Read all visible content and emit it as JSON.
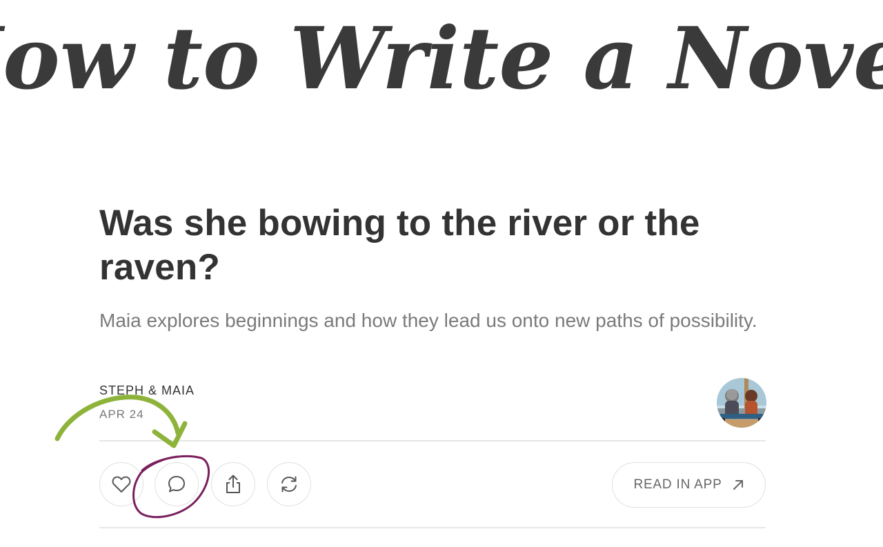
{
  "banner": {
    "text": "How to Write a Novel"
  },
  "post": {
    "title": "Was she bowing to the river or the raven?",
    "subtitle": "Maia explores beginnings and how they lead us onto new paths of possibility.",
    "author": "STEPH & MAIA",
    "date": "APR 24"
  },
  "actions": {
    "like_icon": "heart-icon",
    "comment_icon": "comment-bubble-icon",
    "share_icon": "share-upload-icon",
    "restack_icon": "refresh-icon",
    "read_in_app_label": "READ IN APP",
    "read_in_app_icon": "arrow-up-right-icon"
  },
  "annotations": {
    "arrow_color": "#8db33a",
    "circle_color": "#7a1f5e"
  },
  "colors": {
    "title": "#333333",
    "subtitle": "#7a7a7a",
    "border": "#e0e0e0"
  }
}
